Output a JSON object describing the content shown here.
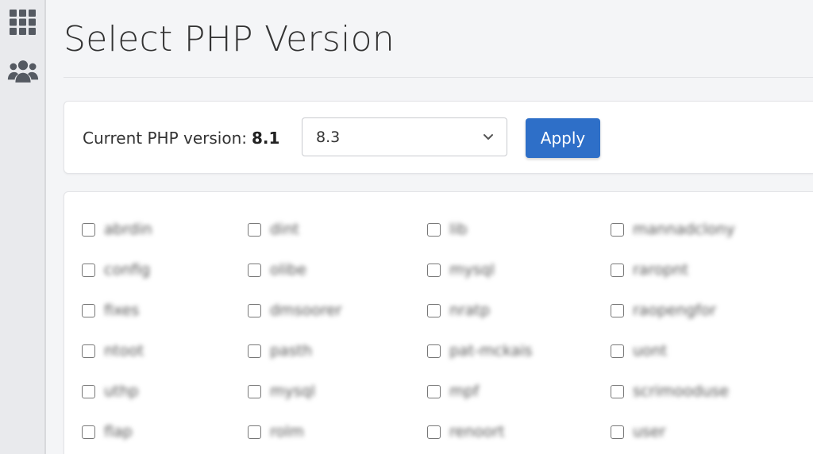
{
  "sidebar": {
    "items": [
      {
        "icon": "apps-grid-icon"
      },
      {
        "icon": "users-icon"
      }
    ]
  },
  "page": {
    "title": "Select PHP Version"
  },
  "version_panel": {
    "current_label": "Current PHP version:",
    "current_value": "8.1",
    "selected_version": "8.3",
    "apply_label": "Apply",
    "accent_color": "#2e6fc8"
  },
  "extensions": {
    "obscured": true,
    "items": [
      {
        "label": "abrdin",
        "checked": false
      },
      {
        "label": "dint",
        "checked": false
      },
      {
        "label": "lib",
        "checked": false
      },
      {
        "label": "mannadclony",
        "checked": false
      },
      {
        "label": "config",
        "checked": false
      },
      {
        "label": "olibe",
        "checked": false
      },
      {
        "label": "mysql",
        "checked": false
      },
      {
        "label": "raropnt",
        "checked": false
      },
      {
        "label": "fixes",
        "checked": false
      },
      {
        "label": "dmsoorer",
        "checked": false
      },
      {
        "label": "nratp",
        "checked": false
      },
      {
        "label": "raopengfor",
        "checked": false
      },
      {
        "label": "ntoot",
        "checked": false
      },
      {
        "label": "pasth",
        "checked": false
      },
      {
        "label": "pat-mckais",
        "checked": false
      },
      {
        "label": "uont",
        "checked": false
      },
      {
        "label": "uthp",
        "checked": false
      },
      {
        "label": "mysql",
        "checked": false
      },
      {
        "label": "mpf",
        "checked": false
      },
      {
        "label": "scrimooduse",
        "checked": false
      },
      {
        "label": "flap",
        "checked": false
      },
      {
        "label": "rolm",
        "checked": false
      },
      {
        "label": "renoort",
        "checked": false
      },
      {
        "label": "user",
        "checked": false
      }
    ]
  }
}
